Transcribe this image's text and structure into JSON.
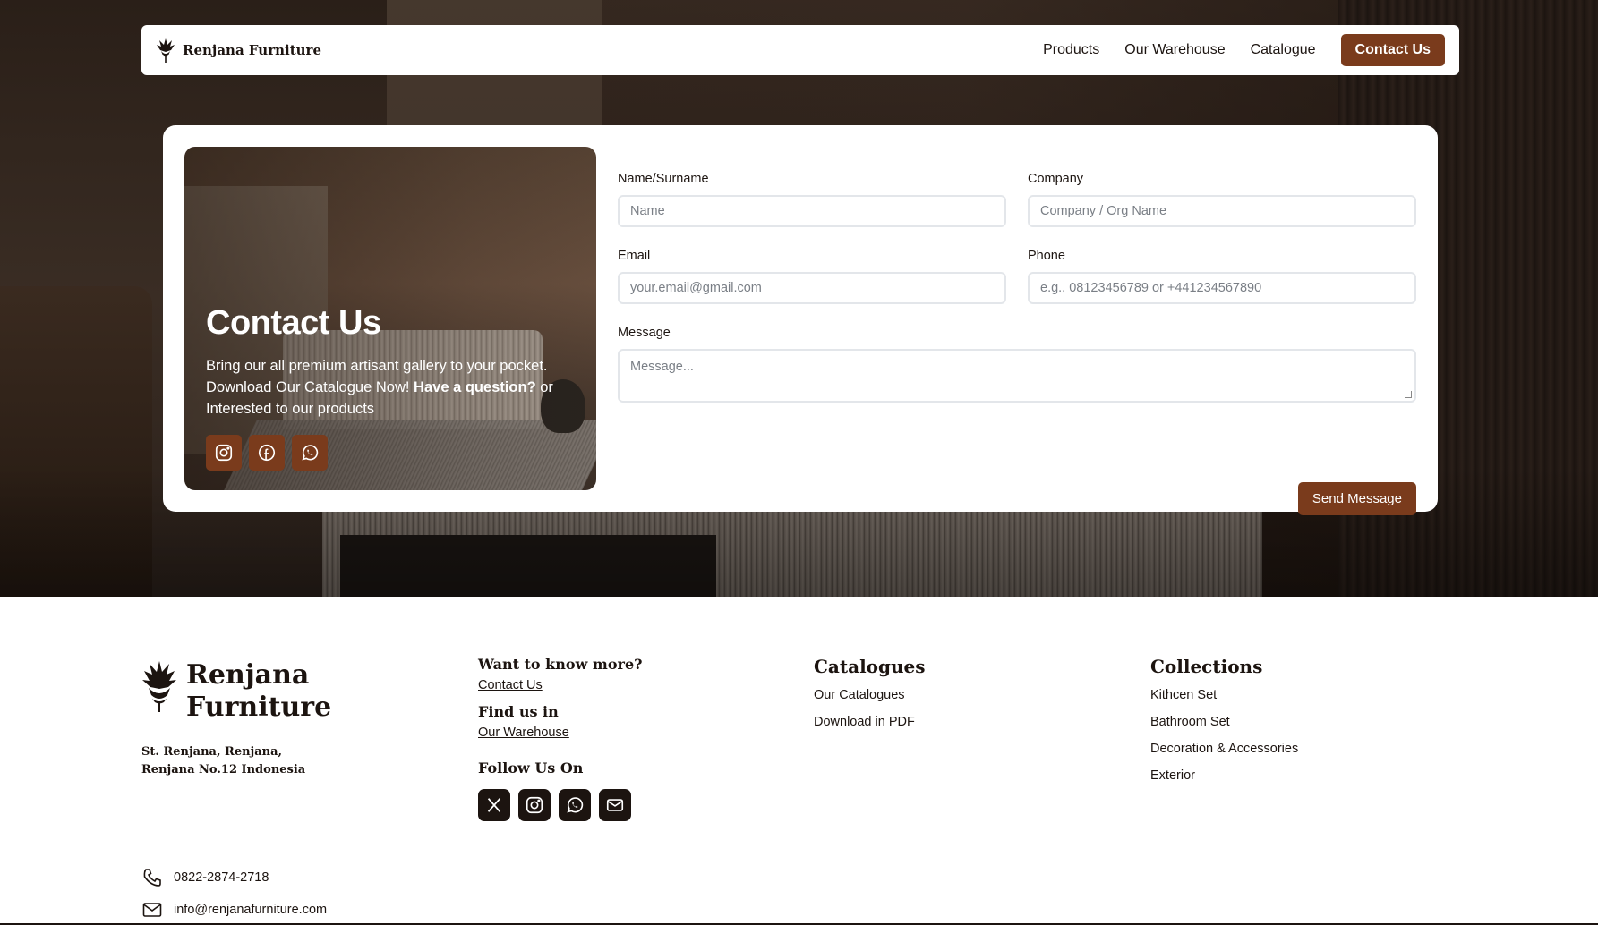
{
  "brand": {
    "name": "Renjana Furniture",
    "logo_icon": "flower-logo-icon"
  },
  "nav": {
    "links": [
      "Products",
      "Our Warehouse",
      "Catalogue"
    ],
    "cta": "Contact Us"
  },
  "hero": {
    "title": "Contact Us",
    "desc_1": "Bring our all premium artisant gallery to your pocket. Download Our Catalogue Now! ",
    "desc_bold": "Have a question?",
    "desc_2": " or Interested to our products",
    "socials": [
      "instagram-icon",
      "facebook-icon",
      "whatsapp-icon"
    ]
  },
  "form": {
    "name_label": "Name/Surname",
    "name_placeholder": "Name",
    "company_label": "Company",
    "company_placeholder": "Company / Org Name",
    "email_label": "Email",
    "email_placeholder": "your.email@gmail.com",
    "phone_label": "Phone",
    "phone_placeholder": "e.g., 08123456789 or +441234567890",
    "message_label": "Message",
    "message_placeholder": "Message...",
    "submit": "Send Message"
  },
  "footer": {
    "brand_line1": "Renjana",
    "brand_line2": "Furniture",
    "address": "St. Renjana, Renjana, Renjana No.12 Indonesia",
    "phone": "0822-2874-2718",
    "email": "info@renjanafurniture.com",
    "know_more": "Want to know more?",
    "contact_link": "Contact Us",
    "find_us": "Find us in",
    "warehouse_link": "Our Warehouse",
    "follow": "Follow Us On",
    "follow_icons": [
      "x-icon",
      "instagram-icon",
      "whatsapp-icon",
      "mail-icon"
    ],
    "catalogues": {
      "title": "Catalogues",
      "items": [
        "Our Catalogues",
        "Download in PDF"
      ]
    },
    "collections": {
      "title": "Collections",
      "items": [
        "Kithcen Set",
        "Bathroom Set",
        "Decoration & Accessories",
        "Exterior"
      ]
    }
  },
  "colors": {
    "accent": "#7a3b1c",
    "dark": "#1c1410"
  }
}
